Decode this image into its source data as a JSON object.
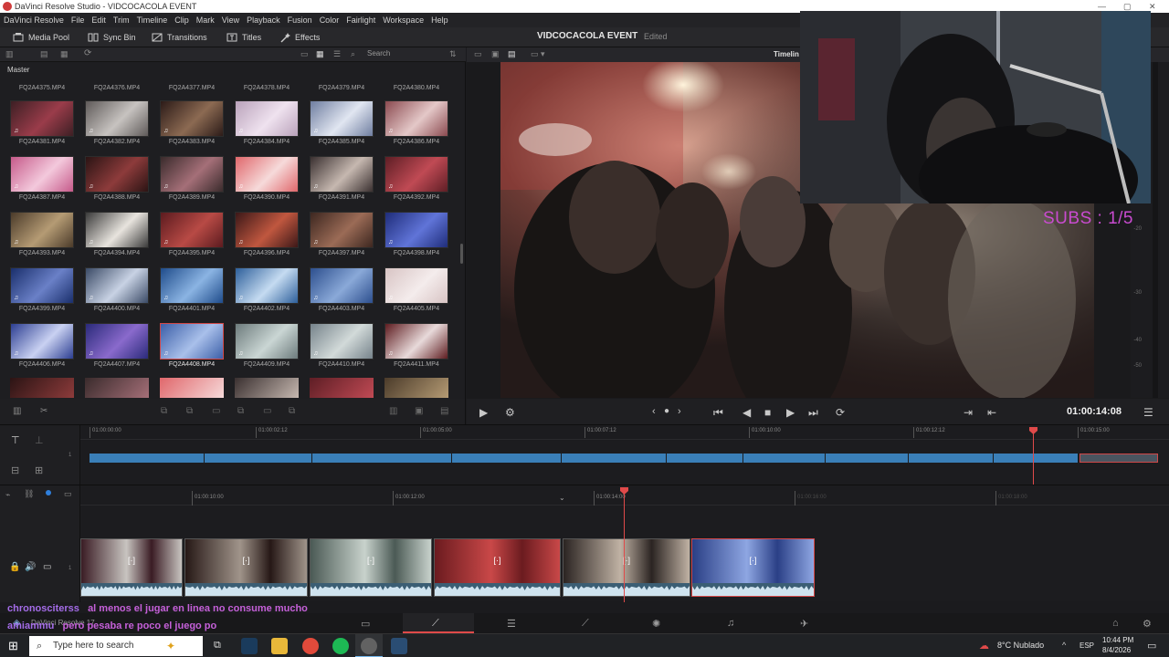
{
  "window": {
    "title": "DaVinci Resolve Studio - VIDCOCACOLA EVENT"
  },
  "menu": [
    "DaVinci Resolve",
    "File",
    "Edit",
    "Trim",
    "Timeline",
    "Clip",
    "Mark",
    "View",
    "Playback",
    "Fusion",
    "Color",
    "Fairlight",
    "Workspace",
    "Help"
  ],
  "toolbar": {
    "media_pool": "Media Pool",
    "sync_bin": "Sync Bin",
    "transitions": "Transitions",
    "titles": "Titles",
    "effects": "Effects",
    "project_title": "VIDCOCACOLA EVENT",
    "project_status": "Edited"
  },
  "media_pool": {
    "search_placeholder": "Search",
    "bin": "Master",
    "top_row": [
      "FQ2A4375.MP4",
      "FQ2A4376.MP4",
      "FQ2A4377.MP4",
      "FQ2A4378.MP4",
      "FQ2A4379.MP4",
      "FQ2A4380.MP4"
    ],
    "rows": [
      [
        "FQ2A4381.MP4",
        "FQ2A4382.MP4",
        "FQ2A4383.MP4",
        "FQ2A4384.MP4",
        "FQ2A4385.MP4",
        "FQ2A4386.MP4"
      ],
      [
        "FQ2A4387.MP4",
        "FQ2A4388.MP4",
        "FQ2A4389.MP4",
        "FQ2A4390.MP4",
        "FQ2A4391.MP4",
        "FQ2A4392.MP4"
      ],
      [
        "FQ2A4393.MP4",
        "FQ2A4394.MP4",
        "FQ2A4395.MP4",
        "FQ2A4396.MP4",
        "FQ2A4397.MP4",
        "FQ2A4398.MP4"
      ],
      [
        "FQ2A4399.MP4",
        "FQ2A4400.MP4",
        "FQ2A4401.MP4",
        "FQ2A4402.MP4",
        "FQ2A4403.MP4",
        "FQ2A4405.MP4"
      ],
      [
        "FQ2A4406.MP4",
        "FQ2A4407.MP4",
        "FQ2A4408.MP4",
        "FQ2A4409.MP4",
        "FQ2A4410.MP4",
        "FQ2A4411.MP4"
      ]
    ],
    "selected_clip": "FQ2A4408.MP4"
  },
  "viewer": {
    "label": "Timelin",
    "timecode": "01:00:14:08",
    "meter_ticks": [
      "-20",
      "-30",
      "-40",
      "-50"
    ]
  },
  "overlay": {
    "subs_counter": "SUBS : 1/5"
  },
  "timeline": {
    "upper_ruler": [
      "01:00:00:00",
      "01:00:02:12",
      "01:00:05:00",
      "01:00:07:12",
      "01:00:10:00",
      "01:00:12:12",
      "01:00:15:00"
    ],
    "lower_ruler": [
      "01:00:10:00",
      "01:00:12:00",
      "01:00:14:00",
      "01:00:16:00",
      "01:00:18:00"
    ],
    "track_number": "1"
  },
  "chat": [
    {
      "user": "chronosciterss",
      "message": "al menos el jugar en linea no consume mucho"
    },
    {
      "user": "amiammu",
      "message": "pero pesaba re poco el juego po"
    }
  ],
  "page_nav": {
    "app_label": "DaVinci Resolve 17"
  },
  "taskbar": {
    "search_placeholder": "Type here to search",
    "weather": "8°C  Nublado",
    "language": "ESP",
    "time": "10:44 PM",
    "date": "8/4/2026"
  }
}
